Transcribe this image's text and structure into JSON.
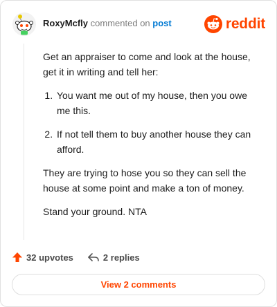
{
  "header": {
    "username": "RoxyMcfly",
    "commented_text": "commented on",
    "post_link": "post",
    "brand": "reddit"
  },
  "comment": {
    "intro": "Get an appraiser to come and look at the house, get it in writing and tell her:",
    "list_items": [
      "You want me out of my house, then you owe me this.",
      "If not tell them to buy another house they can afford."
    ],
    "paragraphs": [
      "They are trying to hose you so they can sell the house at some point and make a ton of money.",
      "Stand your ground. NTA"
    ]
  },
  "actions": {
    "upvotes": "32 upvotes",
    "replies": "2 replies"
  },
  "view_comments": "View 2 comments",
  "colors": {
    "accent": "#ff4500",
    "link": "#0079d3"
  },
  "icons": {
    "avatar": "snoo-avatar",
    "brand": "reddit-alien-logo",
    "upvote": "upvote-arrow-icon",
    "reply": "reply-arrow-icon"
  }
}
